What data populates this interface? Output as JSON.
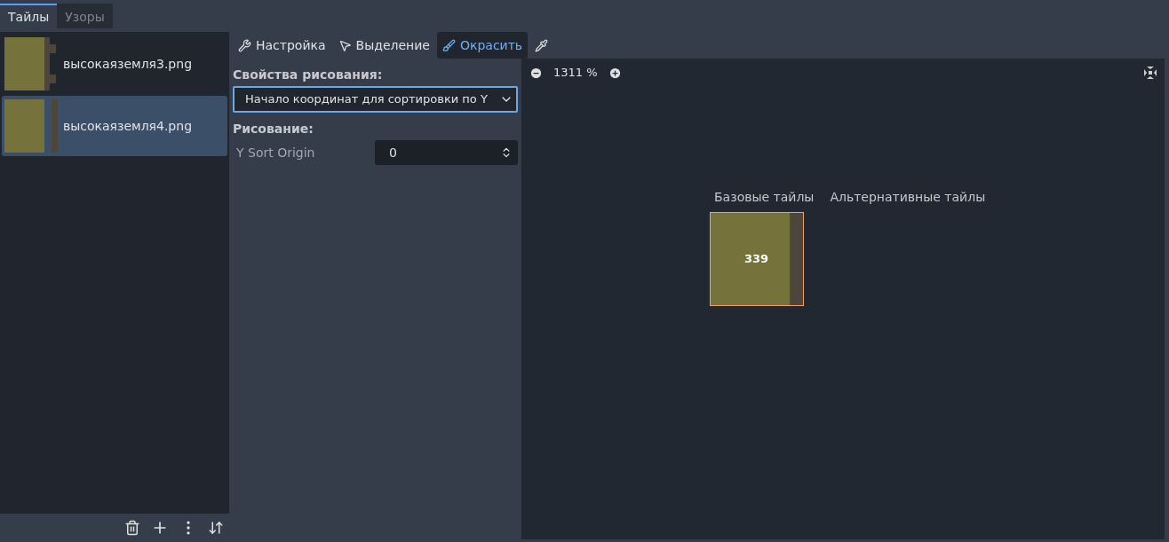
{
  "tabs": [
    {
      "label": "Тайлы",
      "selected": true
    },
    {
      "label": "Узоры",
      "selected": false
    }
  ],
  "sources": [
    {
      "name": "высокаяземля3.png",
      "selected": false,
      "kind": "jagged"
    },
    {
      "name": "высокаяземля4.png",
      "selected": true,
      "kind": "straight"
    }
  ],
  "tools": [
    {
      "kind": "setup",
      "label": "Настройка",
      "selected": false
    },
    {
      "kind": "select",
      "label": "Выделение",
      "selected": false
    },
    {
      "kind": "paint",
      "label": "Окрасить",
      "selected": true
    },
    {
      "kind": "picker",
      "selected": false
    }
  ],
  "paint_properties": {
    "heading": "Свойства рисования:",
    "dropdown": {
      "value": "Начало координат для сортировки по Y"
    },
    "section": "Рисование:",
    "fields": [
      {
        "label": "Y Sort Origin",
        "value": "0"
      }
    ]
  },
  "atlas": {
    "zoom": "1311 %",
    "base_label": "Базовые тайлы",
    "alt_label": "Альтернативные тайлы",
    "tile": {
      "label": "339",
      "selected": true
    }
  }
}
